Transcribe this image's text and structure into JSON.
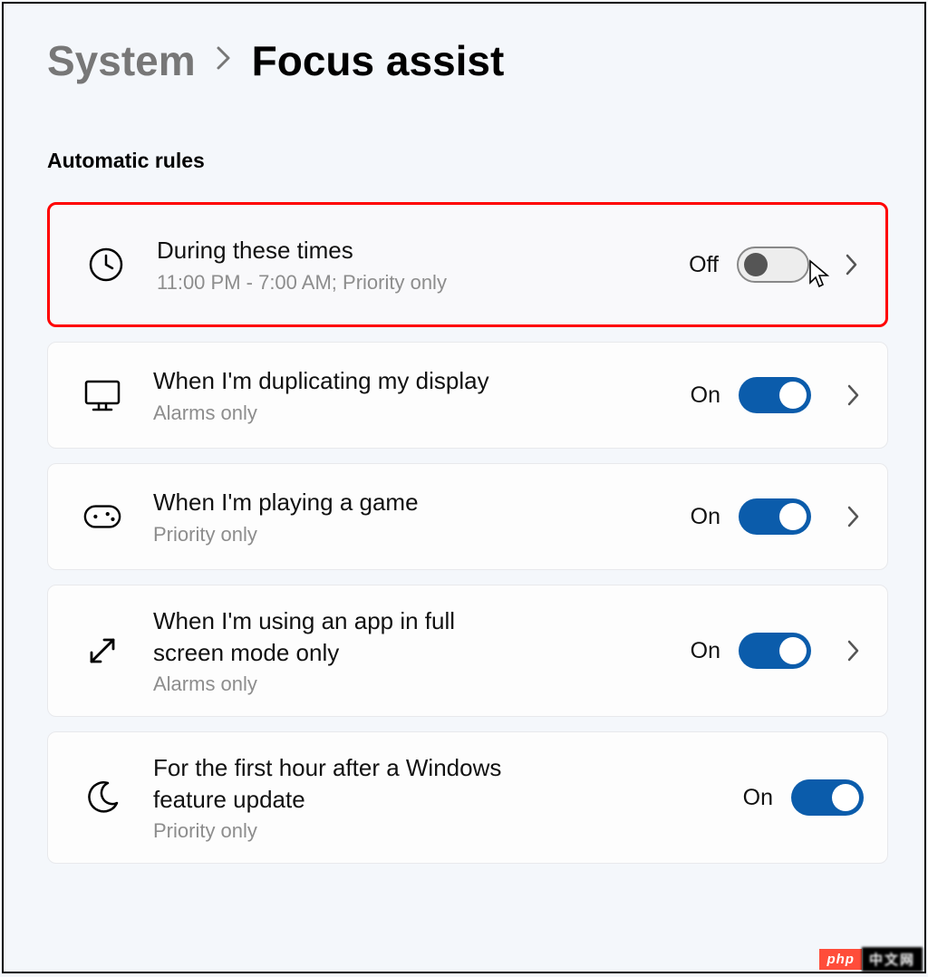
{
  "breadcrumb": {
    "parent": "System",
    "current": "Focus assist"
  },
  "section_title": "Automatic rules",
  "rules": [
    {
      "icon": "clock-icon",
      "title": "During these times",
      "subtitle": "11:00 PM - 7:00 AM; Priority only",
      "state_label": "Off",
      "on": false,
      "has_chevron": true,
      "highlighted": true
    },
    {
      "icon": "monitor-icon",
      "title": "When I'm duplicating my display",
      "subtitle": "Alarms only",
      "state_label": "On",
      "on": true,
      "has_chevron": true,
      "highlighted": false
    },
    {
      "icon": "game-icon",
      "title": "When I'm playing a game",
      "subtitle": "Priority only",
      "state_label": "On",
      "on": true,
      "has_chevron": true,
      "highlighted": false
    },
    {
      "icon": "fullscreen-icon",
      "title": "When I'm using an app in full screen mode only",
      "subtitle": "Alarms only",
      "state_label": "On",
      "on": true,
      "has_chevron": true,
      "highlighted": false
    },
    {
      "icon": "moon-icon",
      "title": "For the first hour after a Windows feature update",
      "subtitle": "Priority only",
      "state_label": "On",
      "on": true,
      "has_chevron": false,
      "highlighted": false
    }
  ],
  "watermark": {
    "badge": "php",
    "zh": "中文网"
  },
  "colors": {
    "accent": "#0b5cab",
    "highlight": "#ff0000",
    "muted": "#8d8d8d"
  }
}
